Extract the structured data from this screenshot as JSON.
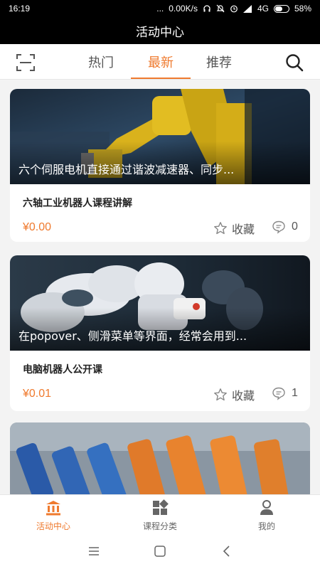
{
  "status_bar": {
    "time": "16:19",
    "dots": "...",
    "speed": "0.00K/s",
    "network": "4G",
    "battery": "58%",
    "battery_level": 0.58
  },
  "header": {
    "title": "活动中心"
  },
  "tabs": [
    {
      "label": "热门",
      "active": false
    },
    {
      "label": "最新",
      "active": true
    },
    {
      "label": "推荐",
      "active": false
    }
  ],
  "courses": [
    {
      "caption": "六个伺服电机直接通过谐波减速器、同步...",
      "title": "六轴工业机器人课程讲解",
      "price": "¥0.00",
      "fav_label": "收藏",
      "comments": "0"
    },
    {
      "caption": "在popover、侧滑菜单等界面，经常会用到...",
      "title": "电脑机器人公开课",
      "price": "¥0.01",
      "fav_label": "收藏",
      "comments": "1"
    }
  ],
  "bottom_nav": [
    {
      "label": "活动中心",
      "icon": "bank-icon",
      "active": true
    },
    {
      "label": "课程分类",
      "icon": "grid-icon",
      "active": false
    },
    {
      "label": "我的",
      "icon": "user-icon",
      "active": false
    }
  ],
  "colors": {
    "accent": "#ef7a2e",
    "header_bg": "#000000",
    "page_bg": "#f3f3f3"
  }
}
